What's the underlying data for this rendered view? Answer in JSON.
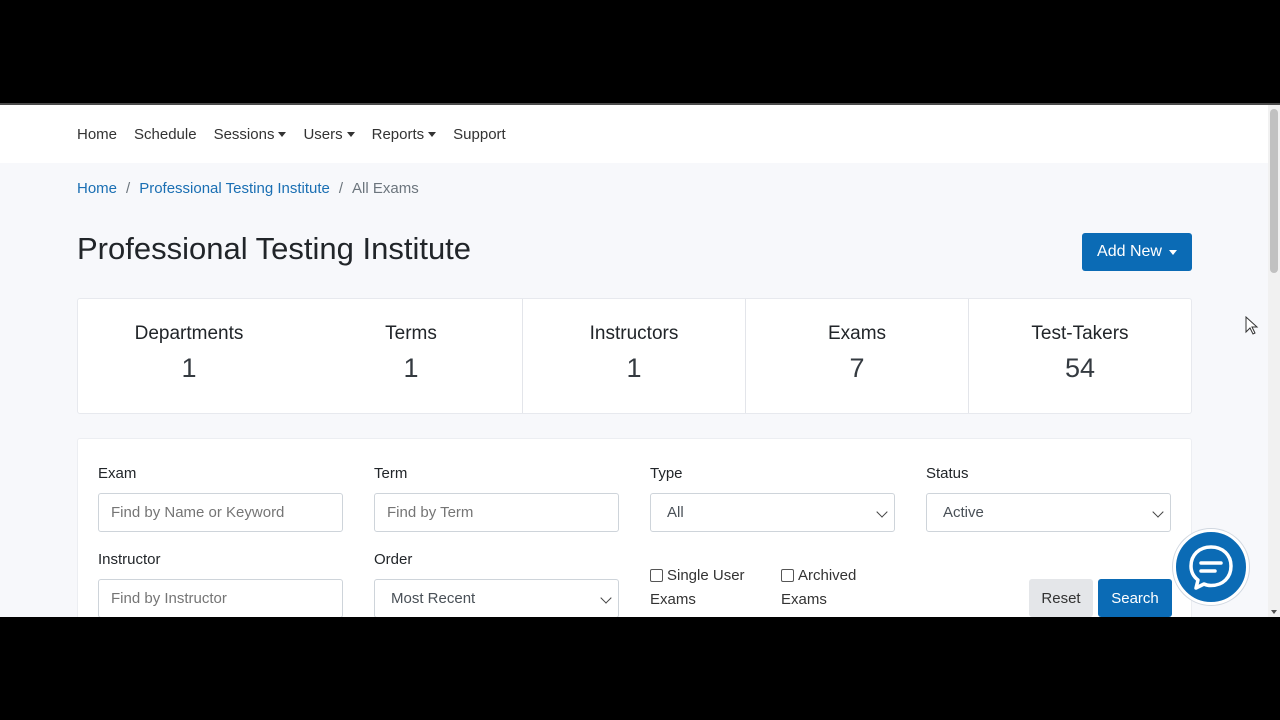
{
  "nav": {
    "items": [
      {
        "label": "Home",
        "dropdown": false
      },
      {
        "label": "Schedule",
        "dropdown": false
      },
      {
        "label": "Sessions",
        "dropdown": true
      },
      {
        "label": "Users",
        "dropdown": true
      },
      {
        "label": "Reports",
        "dropdown": true
      },
      {
        "label": "Support",
        "dropdown": false
      }
    ]
  },
  "breadcrumb": {
    "home": "Home",
    "separator": "/",
    "institute": "Professional Testing Institute",
    "current": "All Exams"
  },
  "page": {
    "title": "Professional Testing Institute",
    "add_new_label": "Add New"
  },
  "stats": [
    {
      "label": "Departments",
      "value": "1"
    },
    {
      "label": "Terms",
      "value": "1"
    },
    {
      "label": "Instructors",
      "value": "1"
    },
    {
      "label": "Exams",
      "value": "7"
    },
    {
      "label": "Test-Takers",
      "value": "54"
    }
  ],
  "filters": {
    "exam": {
      "label": "Exam",
      "placeholder": "Find by Name or Keyword"
    },
    "term": {
      "label": "Term",
      "placeholder": "Find by Term"
    },
    "type": {
      "label": "Type",
      "selected": "All"
    },
    "status": {
      "label": "Status",
      "selected": "Active"
    },
    "instructor": {
      "label": "Instructor",
      "placeholder": "Find by Instructor"
    },
    "order": {
      "label": "Order",
      "selected": "Most Recent"
    },
    "single_user": {
      "line1": "Single User",
      "line2": "Exams",
      "checked": false
    },
    "archived": {
      "line1": "Archived",
      "line2": "Exams",
      "checked": false
    },
    "reset_label": "Reset",
    "search_label": "Search"
  },
  "icons": {
    "chat": "chat-bubble-icon",
    "caret": "caret-down-icon",
    "chevron": "chevron-down-icon",
    "cursor": "mouse-pointer-icon"
  },
  "colors": {
    "primary": "#0b6bb5",
    "link": "#1a6fb3",
    "background": "#f7f8fb"
  }
}
